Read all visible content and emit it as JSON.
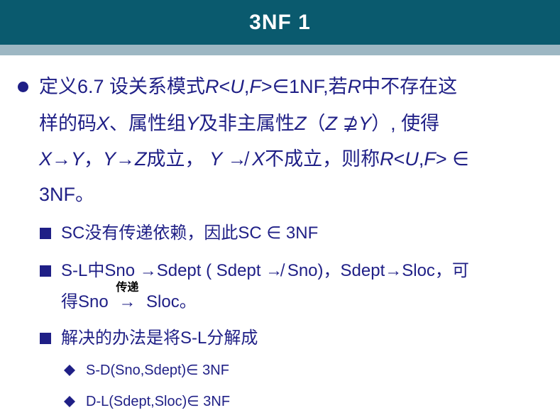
{
  "title": "3NF 1",
  "definition": {
    "line1": {
      "a": "定义6.7  设关系模式",
      "b": "R",
      "c": "<",
      "d": "U",
      "e": ",",
      "f": "F",
      "g": ">∈1NF,若",
      "h": "R",
      "i": "中不存在这"
    },
    "line2": {
      "a": "样的码",
      "b": "X",
      "c": "、属性组",
      "d": "Y",
      "e": "及非主属性",
      "f": "Z",
      "g": "（",
      "h": "Z",
      "i": " ⊉",
      "j": "Y",
      "k": "）, 使得"
    },
    "line3": {
      "a": "X",
      "b": "→",
      "c": "Y",
      "d": "，",
      "e": "Y",
      "f": "→",
      "g": "Z",
      "h": "成立， ",
      "i": "Y",
      "j": " ↛  ",
      "k": "X",
      "l": "不成立，则称",
      "m": "R",
      "n": "<",
      "o": "U",
      "p": ",",
      "q": "F",
      "r": "> ∈"
    },
    "line4": "3NF。"
  },
  "sub1": "SC没有传递依赖，因此SC ∈ 3NF",
  "sub2": {
    "line1": "S-L中Sno →Sdept ( Sdept ↛  Sno)，Sdept→Sloc，可",
    "line2_a": "得Sno ",
    "arrow_label": "传递",
    "arrow": "→",
    "line2_b": "  Sloc。"
  },
  "sub3": "解决的办法是将S-L分解成",
  "items": [
    "S-D(Sno,Sdept)∈ 3NF",
    "D-L(Sdept,Sloc)∈ 3NF"
  ],
  "colors": {
    "header": "#0a5a6e",
    "band": "#9db7c3",
    "text": "#1f1f86"
  }
}
